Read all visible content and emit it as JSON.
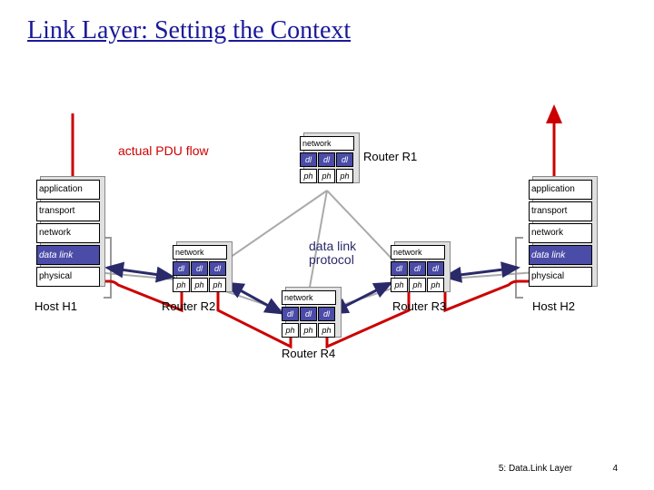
{
  "title": "Link Layer: Setting the Context",
  "footer": {
    "chapter": "5: Data.Link Layer",
    "page": "4"
  },
  "labels": {
    "actual_pdu_flow": "actual PDU flow",
    "data_link_protocol": "data link protocol",
    "host_h1": "Host H1",
    "host_h2": "Host H2",
    "router_r1": "Router R1",
    "router_r2": "Router R2",
    "router_r3": "Router R3",
    "router_r4": "Router R4"
  },
  "host_layers": {
    "application": "application",
    "transport": "transport",
    "network": "network",
    "data_link": "data link",
    "physical": "physical"
  },
  "router_layers": {
    "network": "network",
    "dl": "dl",
    "ph": "ph"
  },
  "colors": {
    "title": "#1a1a99",
    "pdu_flow": "#cc0000",
    "protocol_arrow": "#2a2a6a",
    "dl_highlight": "#4b4ba8",
    "physical_link": "#aaaaaa"
  }
}
